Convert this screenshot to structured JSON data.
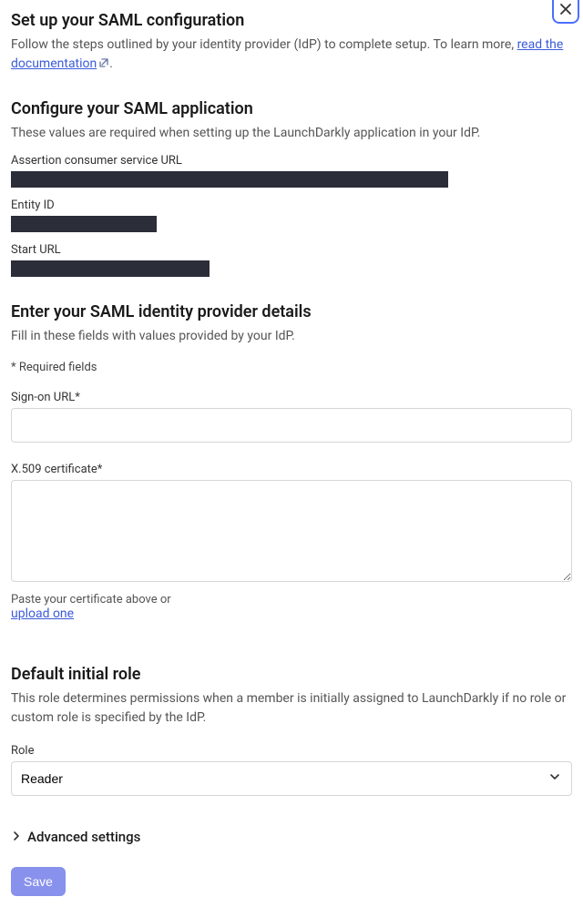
{
  "header": {
    "title": "Set up your SAML configuration",
    "subtext_prefix": "Follow the steps outlined by your identity provider (IdP) to complete setup. To learn more, ",
    "doc_link": "read the documentation",
    "subtext_suffix": "."
  },
  "configure": {
    "title": "Configure your SAML application",
    "subtext": "These values are required when setting up the LaunchDarkly application in your IdP.",
    "acs_label": "Assertion consumer service URL",
    "entity_label": "Entity ID",
    "start_label": "Start URL"
  },
  "idp": {
    "title": "Enter your SAML identity provider details",
    "subtext": "Fill in these fields with values provided by your IdP.",
    "required_note": "* Required fields",
    "signon_label": "Sign-on URL*",
    "signon_value": "",
    "cert_label": "X.509 certificate*",
    "cert_value": "",
    "cert_helper": "Paste your certificate above or",
    "upload_link": "upload one"
  },
  "role": {
    "title": "Default initial role",
    "subtext": "This role determines permissions when a member is initially assigned to LaunchDarkly if no role or custom role is specified by the IdP.",
    "label": "Role",
    "selected": "Reader"
  },
  "advanced_label": "Advanced settings",
  "save_label": "Save"
}
